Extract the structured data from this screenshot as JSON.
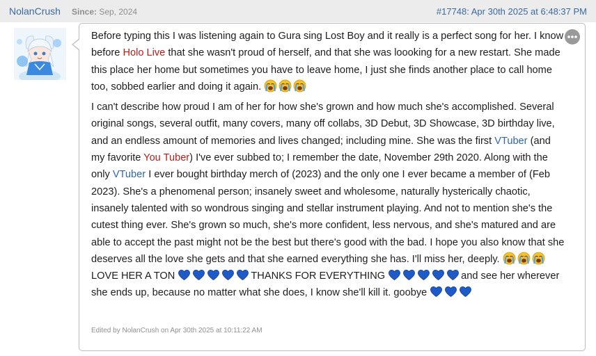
{
  "header": {
    "username": "NolanCrush",
    "since_label": "Since:",
    "since_date": "Sep, 2024",
    "post_link": "#17748: Apr 30th 2025 at 6:48:37 PM"
  },
  "icons": {
    "more": "more-options-icon",
    "crying": "loudly-crying-face-emoji",
    "heart": "blue-heart-emoji"
  },
  "colors": {
    "link_blue": "#2d66b4",
    "link_red": "#b71c1c",
    "header_bg": "#ececec",
    "heart": "#1f5bc8"
  },
  "post": {
    "p1": {
      "t1": "Before typing this I was listening again to Gura sing Lost Boy and it really is a perfect song for her. I know before ",
      "link1": "Holo Live",
      "t2": " that she wasn't proud of herself, and that she was loooking for a new restart. She made this place her home but sometimes you have to leave home, I just she finds another place to call home too, sobbed earlier and doing it again. "
    },
    "p2": {
      "t1": "I can't describe how proud I am of her for how she's grown and how much she's accomplished. Several original songs, several outfit, many covers, many off collabs, 3D Debut, 3D Showcase, 3D birthday live, and an endless amount of memories and lives changed; including mine. She was the first ",
      "link1": "VTuber",
      "t2": " (and my favorite ",
      "link2": "You Tuber",
      "t3": ") I've ever subbed to; I remember the date, November 29th 2020. Along with the only ",
      "link3": "VTuber",
      "t4": " I ever bought birthday merch of (2023) and the only one I ever became a member of (Feb 2023). She's a phenomenal person; insanely sweet and wholesome, naturally hysterically chaotic, insanely talented with so wondrous singing and stellar instrument playing. And not to mention she's the cutest thing ever. She's grown so much, she's more confident, less nervous, and she's matured and are able to accept the past might not be the best but there's good with the bad. I hope you also know that she deserves all the love she gets and that she earned everything she has. I'll miss her, deeply. ",
      "t5": " LOVE HER A TON ",
      "t6": "THANKS FOR EVERYTHING ",
      "t7": "and see her wherever she ends up, because no matter what she does, I know she'll kill it. gooby",
      "t8": "e "
    },
    "edited": "Edited by NolanCrush on Apr 30th 2025 at 10:11:22 AM"
  }
}
